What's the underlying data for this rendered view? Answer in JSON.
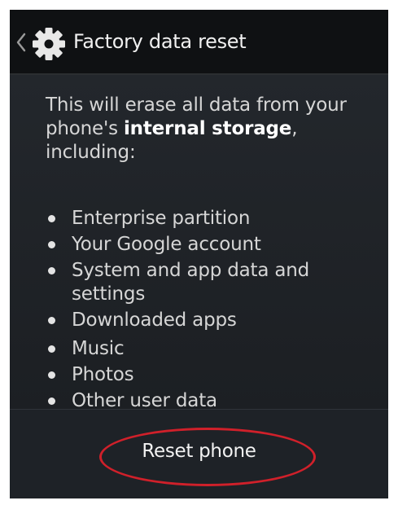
{
  "action_bar": {
    "title": "Factory data reset",
    "up_icon": "chevron-left-icon",
    "app_icon": "gear-icon"
  },
  "content": {
    "intro_part1": "This will erase all data from your phone's ",
    "intro_bold": "internal storage",
    "intro_part2": ", including:",
    "items": [
      "Enterprise partition",
      "Your Google account",
      "System and app data and settings",
      "Downloaded apps",
      "Music",
      "Photos",
      "Other user data"
    ]
  },
  "footer": {
    "reset_label": "Reset phone"
  },
  "colors": {
    "background": "#1e2227",
    "action_bar": "#0f1113",
    "highlight_ring": "#d0202a",
    "text": "#d6d6d6"
  }
}
